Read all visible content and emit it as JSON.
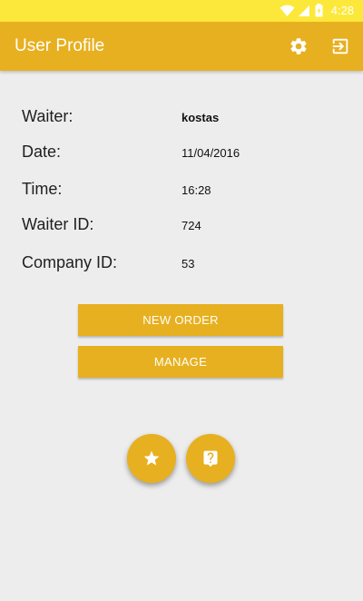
{
  "status_bar": {
    "time": "4:28",
    "icons": [
      "wifi-icon",
      "signal-icon",
      "battery-charging-icon"
    ]
  },
  "app_bar": {
    "title": "User Profile",
    "actions": [
      "settings-icon",
      "logout-icon"
    ]
  },
  "profile": {
    "waiter_label": "Waiter:",
    "waiter_value": "kostas",
    "date_label": "Date:",
    "date_value": "11/04/2016",
    "time_label": "Time:",
    "time_value": "16:28",
    "waiter_id_label": "Waiter ID:",
    "waiter_id_value": "724",
    "company_id_label": "Company ID:",
    "company_id_value": "53"
  },
  "buttons": {
    "new_order": "NEW ORDER",
    "manage": "MANAGE"
  },
  "fabs": [
    "star-icon",
    "help-icon"
  ],
  "colors": {
    "status_bar": "#fce83a",
    "primary": "#e7b020",
    "background": "#ededed"
  }
}
